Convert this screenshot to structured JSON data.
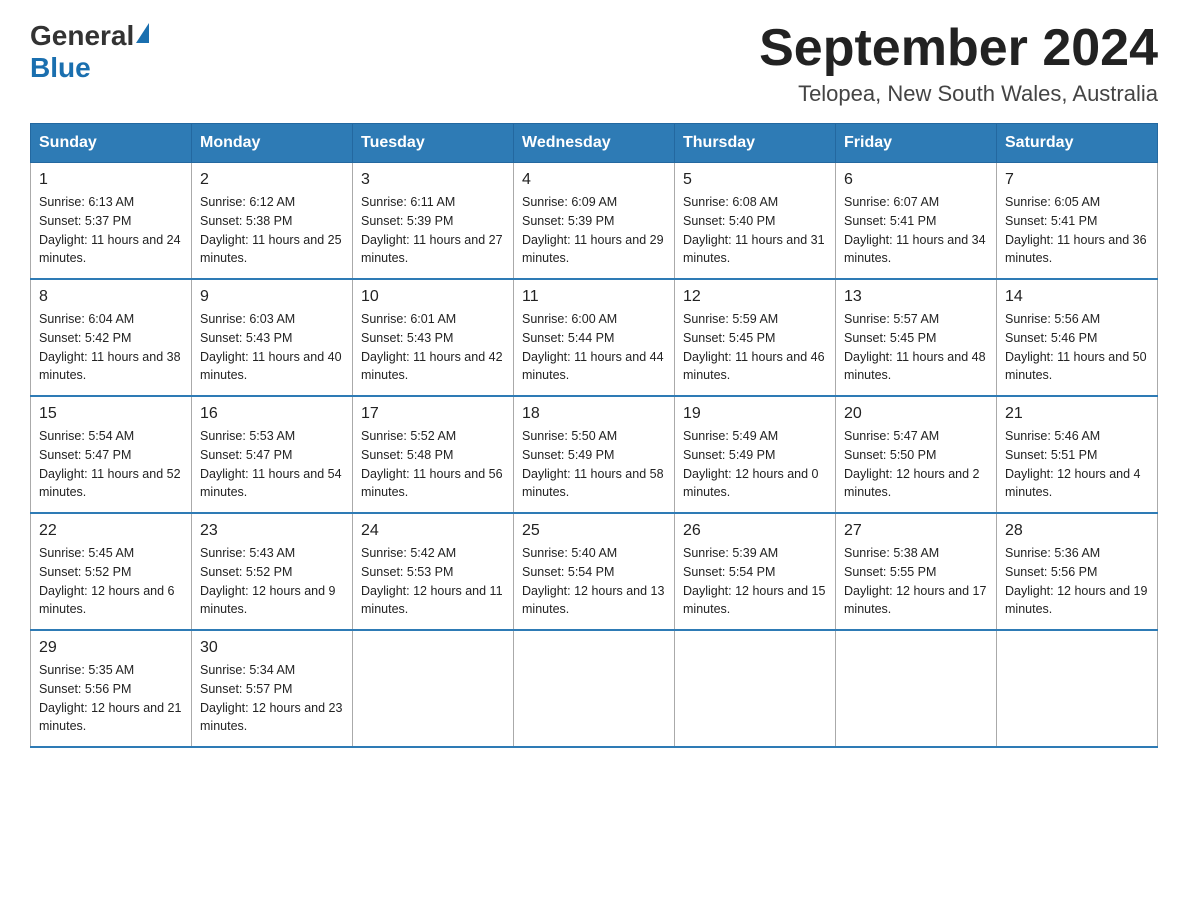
{
  "header": {
    "logo_general": "General",
    "logo_blue": "Blue",
    "month_title": "September 2024",
    "location": "Telopea, New South Wales, Australia"
  },
  "weekdays": [
    "Sunday",
    "Monday",
    "Tuesday",
    "Wednesday",
    "Thursday",
    "Friday",
    "Saturday"
  ],
  "weeks": [
    [
      {
        "day": "1",
        "sunrise": "6:13 AM",
        "sunset": "5:37 PM",
        "daylight": "11 hours and 24 minutes."
      },
      {
        "day": "2",
        "sunrise": "6:12 AM",
        "sunset": "5:38 PM",
        "daylight": "11 hours and 25 minutes."
      },
      {
        "day": "3",
        "sunrise": "6:11 AM",
        "sunset": "5:39 PM",
        "daylight": "11 hours and 27 minutes."
      },
      {
        "day": "4",
        "sunrise": "6:09 AM",
        "sunset": "5:39 PM",
        "daylight": "11 hours and 29 minutes."
      },
      {
        "day": "5",
        "sunrise": "6:08 AM",
        "sunset": "5:40 PM",
        "daylight": "11 hours and 31 minutes."
      },
      {
        "day": "6",
        "sunrise": "6:07 AM",
        "sunset": "5:41 PM",
        "daylight": "11 hours and 34 minutes."
      },
      {
        "day": "7",
        "sunrise": "6:05 AM",
        "sunset": "5:41 PM",
        "daylight": "11 hours and 36 minutes."
      }
    ],
    [
      {
        "day": "8",
        "sunrise": "6:04 AM",
        "sunset": "5:42 PM",
        "daylight": "11 hours and 38 minutes."
      },
      {
        "day": "9",
        "sunrise": "6:03 AM",
        "sunset": "5:43 PM",
        "daylight": "11 hours and 40 minutes."
      },
      {
        "day": "10",
        "sunrise": "6:01 AM",
        "sunset": "5:43 PM",
        "daylight": "11 hours and 42 minutes."
      },
      {
        "day": "11",
        "sunrise": "6:00 AM",
        "sunset": "5:44 PM",
        "daylight": "11 hours and 44 minutes."
      },
      {
        "day": "12",
        "sunrise": "5:59 AM",
        "sunset": "5:45 PM",
        "daylight": "11 hours and 46 minutes."
      },
      {
        "day": "13",
        "sunrise": "5:57 AM",
        "sunset": "5:45 PM",
        "daylight": "11 hours and 48 minutes."
      },
      {
        "day": "14",
        "sunrise": "5:56 AM",
        "sunset": "5:46 PM",
        "daylight": "11 hours and 50 minutes."
      }
    ],
    [
      {
        "day": "15",
        "sunrise": "5:54 AM",
        "sunset": "5:47 PM",
        "daylight": "11 hours and 52 minutes."
      },
      {
        "day": "16",
        "sunrise": "5:53 AM",
        "sunset": "5:47 PM",
        "daylight": "11 hours and 54 minutes."
      },
      {
        "day": "17",
        "sunrise": "5:52 AM",
        "sunset": "5:48 PM",
        "daylight": "11 hours and 56 minutes."
      },
      {
        "day": "18",
        "sunrise": "5:50 AM",
        "sunset": "5:49 PM",
        "daylight": "11 hours and 58 minutes."
      },
      {
        "day": "19",
        "sunrise": "5:49 AM",
        "sunset": "5:49 PM",
        "daylight": "12 hours and 0 minutes."
      },
      {
        "day": "20",
        "sunrise": "5:47 AM",
        "sunset": "5:50 PM",
        "daylight": "12 hours and 2 minutes."
      },
      {
        "day": "21",
        "sunrise": "5:46 AM",
        "sunset": "5:51 PM",
        "daylight": "12 hours and 4 minutes."
      }
    ],
    [
      {
        "day": "22",
        "sunrise": "5:45 AM",
        "sunset": "5:52 PM",
        "daylight": "12 hours and 6 minutes."
      },
      {
        "day": "23",
        "sunrise": "5:43 AM",
        "sunset": "5:52 PM",
        "daylight": "12 hours and 9 minutes."
      },
      {
        "day": "24",
        "sunrise": "5:42 AM",
        "sunset": "5:53 PM",
        "daylight": "12 hours and 11 minutes."
      },
      {
        "day": "25",
        "sunrise": "5:40 AM",
        "sunset": "5:54 PM",
        "daylight": "12 hours and 13 minutes."
      },
      {
        "day": "26",
        "sunrise": "5:39 AM",
        "sunset": "5:54 PM",
        "daylight": "12 hours and 15 minutes."
      },
      {
        "day": "27",
        "sunrise": "5:38 AM",
        "sunset": "5:55 PM",
        "daylight": "12 hours and 17 minutes."
      },
      {
        "day": "28",
        "sunrise": "5:36 AM",
        "sunset": "5:56 PM",
        "daylight": "12 hours and 19 minutes."
      }
    ],
    [
      {
        "day": "29",
        "sunrise": "5:35 AM",
        "sunset": "5:56 PM",
        "daylight": "12 hours and 21 minutes."
      },
      {
        "day": "30",
        "sunrise": "5:34 AM",
        "sunset": "5:57 PM",
        "daylight": "12 hours and 23 minutes."
      },
      null,
      null,
      null,
      null,
      null
    ]
  ],
  "labels": {
    "sunrise": "Sunrise: ",
    "sunset": "Sunset: ",
    "daylight": "Daylight: "
  }
}
